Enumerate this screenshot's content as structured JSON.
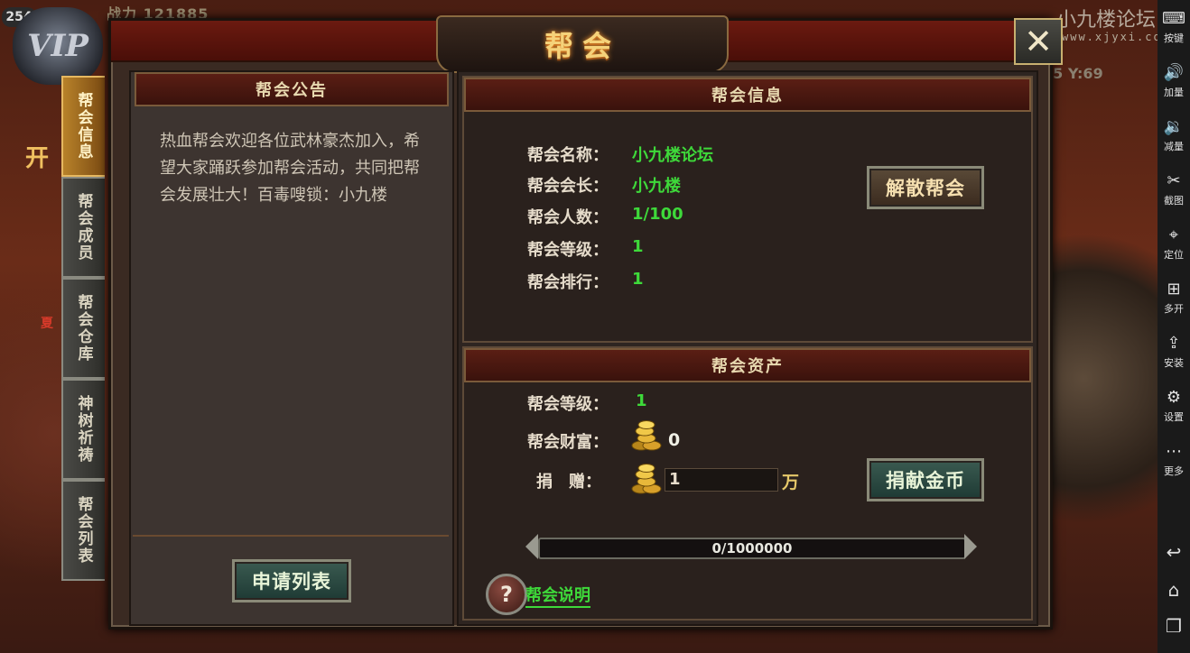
{
  "hud": {
    "level_badge": "254",
    "vip_label": "VIP",
    "power_text": "战力 121885",
    "coords_text": "55 Y:69",
    "side_event_1": "开",
    "side_event_2": "夏"
  },
  "watermark": {
    "title": "小九楼论坛",
    "url": "www.xjyxi.com"
  },
  "window": {
    "title": "帮会",
    "close_label": "✕"
  },
  "tabs": [
    {
      "label": "帮会信息",
      "active": true
    },
    {
      "label": "帮会成员",
      "active": false
    },
    {
      "label": "帮会仓库",
      "active": false
    },
    {
      "label": "神树祈祷",
      "active": false
    },
    {
      "label": "帮会列表",
      "active": false
    }
  ],
  "notice": {
    "header": "帮会公告",
    "text": "热血帮会欢迎各位武林豪杰加入，希望大家踊跃参加帮会活动，共同把帮会发展壮大！百毒嗖锁：小九楼",
    "apply_button": "申请列表"
  },
  "info": {
    "header": "帮会信息",
    "rows": [
      {
        "label": "帮会名称：",
        "value": "小九楼论坛"
      },
      {
        "label": "帮会会长：",
        "value": "小九楼"
      },
      {
        "label": "帮会人数：",
        "value": "1/100"
      },
      {
        "label": "帮会等级：",
        "value": "1"
      },
      {
        "label": "帮会排行：",
        "value": "1"
      }
    ],
    "disband_button": "解散帮会"
  },
  "assets": {
    "header": "帮会资产",
    "level_label": "帮会等级：",
    "level_value": "1",
    "wealth_label": "帮会财富：",
    "wealth_value": "0",
    "donate_label": "捐　赠：",
    "donate_input": "1",
    "donate_unit": "万",
    "donate_button": "捐献金币",
    "progress_text": "0/1000000",
    "progress_fraction": 0,
    "help_icon": "?",
    "help_link": "帮会说明"
  },
  "emulator_sidebar": [
    {
      "icon": "keyboard-icon",
      "glyph": "⌨",
      "label": "按键"
    },
    {
      "icon": "volume-up-icon",
      "glyph": "🔊",
      "label": "加量"
    },
    {
      "icon": "volume-down-icon",
      "glyph": "🔉",
      "label": "减量"
    },
    {
      "icon": "scissors-icon",
      "glyph": "✂",
      "label": "截图"
    },
    {
      "icon": "location-icon",
      "glyph": "⌖",
      "label": "定位"
    },
    {
      "icon": "multi-window-icon",
      "glyph": "⊞",
      "label": "多开"
    },
    {
      "icon": "apk-icon",
      "glyph": "⇪",
      "label": "安装"
    },
    {
      "icon": "gear-icon",
      "glyph": "⚙",
      "label": "设置"
    },
    {
      "icon": "more-icon",
      "glyph": "⋯",
      "label": "更多"
    }
  ],
  "emulator_nav": [
    {
      "icon": "back-icon",
      "glyph": "↩"
    },
    {
      "icon": "home-icon",
      "glyph": "⌂"
    },
    {
      "icon": "recent-apps-icon",
      "glyph": "❐"
    }
  ]
}
